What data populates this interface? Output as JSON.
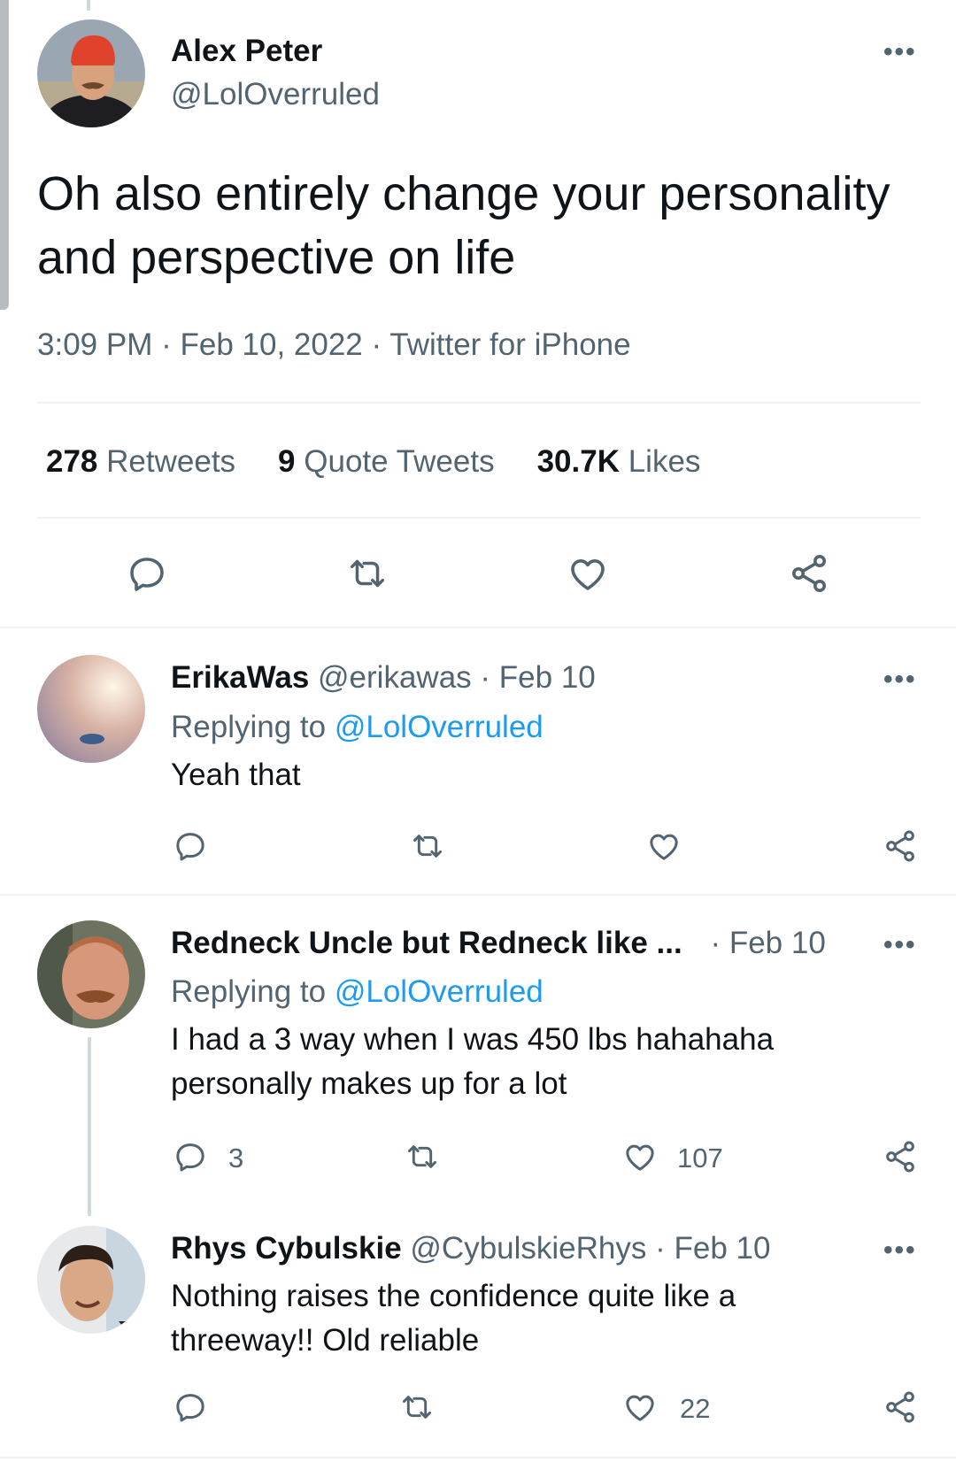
{
  "tweet": {
    "name": "Alex Peter",
    "handle": "@LolOverruled",
    "text": "Oh also entirely change your personality and perspective on life",
    "time": "3:09 PM",
    "date": "Feb 10, 2022",
    "source": "Twitter for iPhone",
    "sep": "·",
    "retweets_count": "278",
    "retweets_label": "Retweets",
    "quotes_count": "9",
    "quotes_label": "Quote Tweets",
    "likes_count": "30.7K",
    "likes_label": "Likes"
  },
  "more_glyph": "•••",
  "replies": [
    {
      "name": "ErikaWas",
      "handle": "@erikawas",
      "date": "· Feb 10",
      "replying_prefix": "Replying to",
      "replying_handle": "@LolOverruled",
      "text": "Yeah that"
    },
    {
      "name": "Redneck Uncle but Redneck like ...",
      "date": "· Feb 10",
      "replying_prefix": "Replying to",
      "replying_handle": "@LolOverruled",
      "text": "I had a 3 way when I was 450 lbs hahahaha personally makes up for a lot",
      "reply_count": "3",
      "like_count": "107"
    },
    {
      "name": "Rhys Cybulskie",
      "handle": "@CybulskieRhys",
      "date": "· Feb 10",
      "text": "Nothing raises the confidence quite like a threeway!! Old reliable",
      "like_count": "22"
    }
  ],
  "icons": [
    "reply-icon",
    "retweet-icon",
    "like-icon",
    "share-icon",
    "more-icon"
  ],
  "colors": {
    "link": "#1d9bf0",
    "muted": "#536471",
    "text": "#0f1419",
    "divider": "#eff3f4"
  }
}
